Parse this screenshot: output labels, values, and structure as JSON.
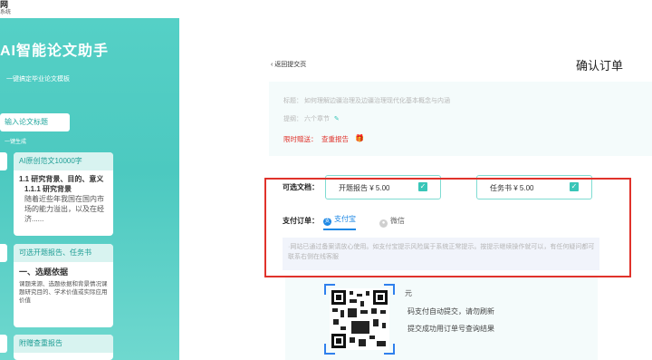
{
  "logo": {
    "line1": "网",
    "line2": "系统"
  },
  "sidebar": {
    "title": "AI智能论文助手",
    "subtitle": "一键搞定毕业论文模板",
    "input_button": "输入论文标题",
    "generate_hint": "一键生成",
    "card1": {
      "header": "AI原创范文10000字",
      "h1": "1.1 研究背景、目的、意义",
      "h2": "1.1.1 研究背景",
      "paragraph": "随着近些年我国在国内市场的能力溢出，以及在经济......"
    },
    "card2": {
      "header": "可选开题报告、任务书",
      "heading": "一、选题依据",
      "paragraph": "课题来源、选题依据和背景情况课题研究目的、学术价值或实际应用价值"
    },
    "card3": {
      "header": "附赠查重报告"
    }
  },
  "main": {
    "back_link": "返回提交页",
    "page_title": "确认订单",
    "info": {
      "title_line": "标题：  如何理解边疆治理及边疆治理现代化基本概念与内涵",
      "outline_line": "提纲：  六个章节",
      "edit_icon": "pencil-icon",
      "gift_label": "限时赠送：",
      "gift_value": "查重报告",
      "gift_icon": "gift-icon"
    },
    "options": {
      "label": "可选文档：",
      "items": [
        {
          "name": "开题报告  ¥ 5.00",
          "checked": true
        },
        {
          "name": "任务书  ¥ 5.00",
          "checked": true
        }
      ]
    },
    "payment": {
      "label": "支付订单：",
      "methods": [
        "支付宝",
        "微信"
      ],
      "selected": "支付宝"
    },
    "notice": "·网站已通过备案请放心使用。如支付宝提示风险属于系统正常提示。按提示继续操作就可以，有任何疑问都可联系右侧在线客服",
    "scan": {
      "line1": "元",
      "line2": "码支付自动提交，请勿刷新",
      "line3": "提交成功用订单号查询结果"
    }
  },
  "colors": {
    "accent": "#4cc9c0",
    "highlight_box": "#e0322b",
    "alipay": "#1e88e5",
    "gift": "#e0322b"
  }
}
